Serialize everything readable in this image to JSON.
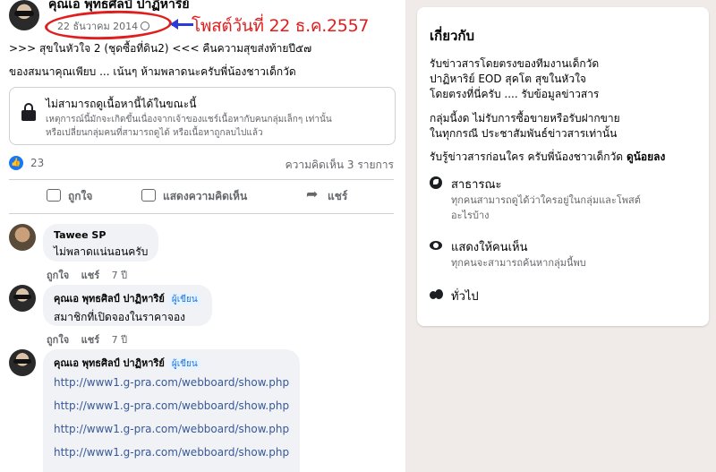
{
  "post": {
    "author": "คุณเอ พุทธศิลป์ ปาฏิหาริย์",
    "date": "22 ธันวาคม 2014",
    "annotation": "โพสต์วันที่ 22 ธ.ค.2557",
    "line1": ">>> สุขในหัวใจ 2 (ชุดซื้อที่ดิน2) <<< คืนความสุขส่งท้ายปี๕๗",
    "line2": "ของสมนาคุณเพียบ ... เน้นๆ ห้ามพลาดนะครับพี่น้องชาวเด็กวัด",
    "unavailable_title": "ไม่สามารถดูเนื้อหานี้ได้ในขณะนี้",
    "unavailable_desc_1": "เหตุการณ์นี้มักจะเกิดขึ้นเนื่องจากเจ้าของแชร์เนื้อหากับคนกลุ่มเล็กๆ เท่านั้น",
    "unavailable_desc_2": "หรือเปลี่ยนกลุ่มคนที่สามารถดูได้ หรือเนื้อหาถูกลบไปแล้ว",
    "like_count": "23",
    "comment_count": "ความคิดเห็น 3 รายการ",
    "actions": {
      "like": "ถูกใจ",
      "comment": "แสดงความคิดเห็น",
      "share": "แชร์"
    }
  },
  "comments": [
    {
      "name": "Tawee SP",
      "text": "ไม่พลาดแน่นอนครับ",
      "like": "ถูกใจ",
      "share": "แชร์",
      "age": "7 ปี"
    },
    {
      "name": "คุณเอ พุทธศิลป์ ปาฏิหาริย์",
      "badge": "ผู้เขียน",
      "text": "สมาชิกที่เปิดจองในราคาจอง",
      "like": "ถูกใจ",
      "share": "แชร์",
      "age": "7 ปี"
    },
    {
      "name": "คุณเอ พุทธศิลป์ ปาฏิหาริย์",
      "badge": "ผู้เขียน",
      "links": [
        "http://www1.g-pra.com/webboard/show.php",
        "http://www1.g-pra.com/webboard/show.php",
        "http://www1.g-pra.com/webboard/show.php",
        "http://www1.g-pra.com/webboard/show.php"
      ]
    }
  ],
  "about": {
    "title": "เกี่ยวกับ",
    "desc_1": "รับข่าวสารโดยตรงของทีมงานเด็กวัด",
    "desc_2": "ปาฏิหาริย์ EOD สุคโต สุขในหัวใจ",
    "desc_3": "โดยตรงที่นี่ครับ .... รับข้อมูลข่าวสาร",
    "desc_4": "กลุ่มนี้งด ไม่รับการซื้อขายหรือรับฝากขาย",
    "desc_5": "ในทุกกรณี ประชาสัมพันธ์ข่าวสารเท่านั้น",
    "desc_6": "รับรู้ข่าวสารก่อนใคร ครับพี่น้องชาวเด็กวัด",
    "desc_6_bold": "ดูน้อยลง",
    "public_label": "สาธารณะ",
    "public_desc_1": "ทุกคนสามารถดูได้ว่าใครอยู่ในกลุ่มและโพสต์",
    "public_desc_2": "อะไรบ้าง",
    "visible_label": "แสดงให้คนเห็น",
    "visible_desc": "ทุกคนจะสามารถค้นหากลุ่มนี้พบ",
    "general_label": "ทั่วไป"
  }
}
